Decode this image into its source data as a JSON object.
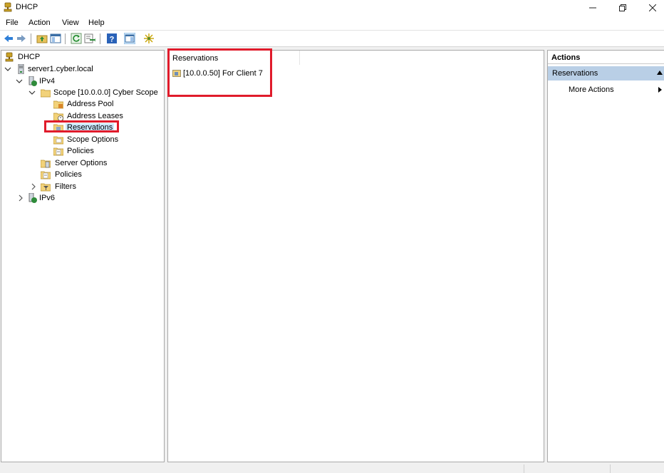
{
  "window": {
    "title": "DHCP"
  },
  "menu": [
    "File",
    "Action",
    "View",
    "Help"
  ],
  "toolbar": {
    "buttons": [
      "back-icon",
      "forward-icon",
      "up-folder-icon",
      "show-hide-tree-icon",
      "refresh-icon",
      "export-list-icon",
      "help-icon",
      "show-hide-action-pane-icon",
      "add-server-icon"
    ]
  },
  "tree": {
    "root": "DHCP",
    "server": "server1.cyber.local",
    "ipv4": "IPv4",
    "scope": "Scope [10.0.0.0] Cyber Scope",
    "address_pool": "Address Pool",
    "address_leases": "Address Leases",
    "reservations": "Reservations",
    "scope_options": "Scope Options",
    "scope_policies": "Policies",
    "server_options": "Server Options",
    "ipv4_policies": "Policies",
    "filters": "Filters",
    "ipv6": "IPv6"
  },
  "results": {
    "column_header": "Reservations",
    "items": [
      "[10.0.0.50] For Client 7"
    ]
  },
  "actions": {
    "title": "Actions",
    "section": "Reservations",
    "more": "More Actions"
  },
  "colors": {
    "annotation": "#e01b2b",
    "actions_section_bg": "#b9cfe6",
    "selection_bg": "#cce8ff"
  }
}
